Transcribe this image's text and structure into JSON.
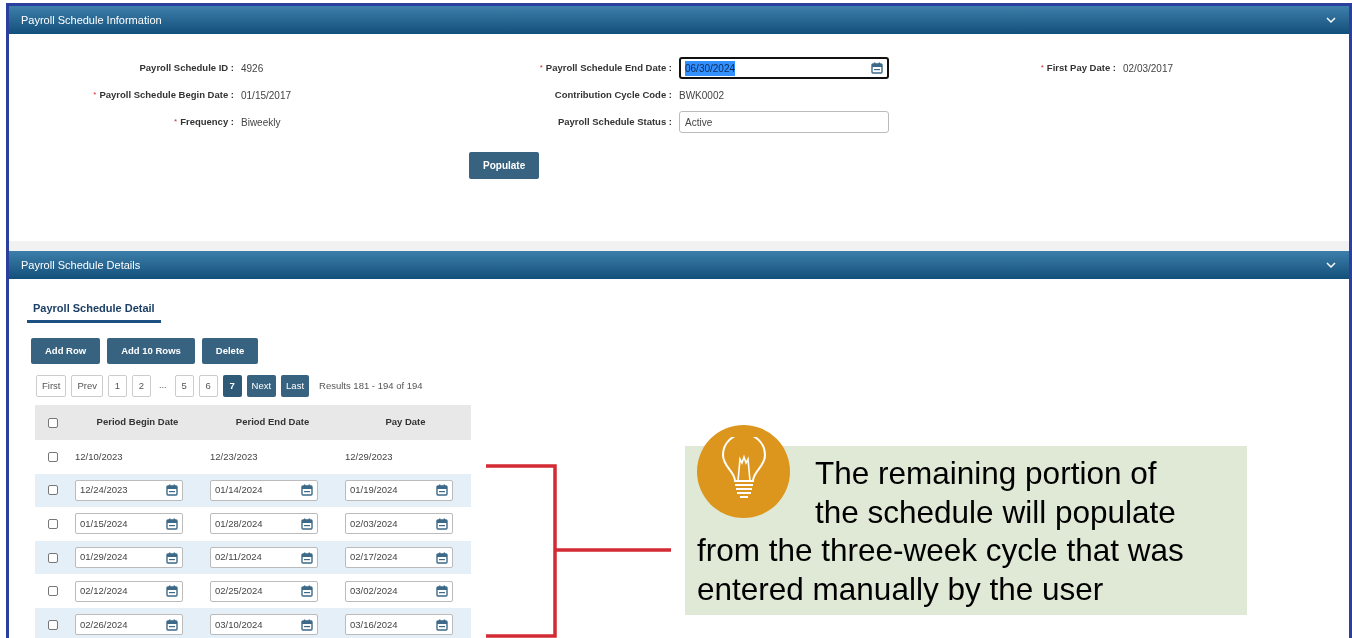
{
  "info_section": {
    "title": "Payroll Schedule Information",
    "expanded": true,
    "left_fields": [
      {
        "label": "Payroll Schedule ID :",
        "value": "4926",
        "kind": "text"
      },
      {
        "marker": "*",
        "label": "Payroll Schedule Begin Date :",
        "value": "01/15/2017",
        "kind": "text"
      },
      {
        "marker": "*",
        "label": "Frequency :",
        "value": "Biweekly",
        "kind": "text"
      }
    ],
    "middle_fields": [
      {
        "marker": "*",
        "label": "Payroll Schedule End Date :",
        "value": "06/30/2024",
        "kind": "date",
        "focused": true
      },
      {
        "label": "Contribution Cycle Code :",
        "value": "BWK0002",
        "kind": "text"
      },
      {
        "label": "Payroll Schedule Status :",
        "value": "Active",
        "kind": "input"
      }
    ],
    "right_fields": [
      {
        "marker": "*",
        "label": "First Pay Date :",
        "value": "02/03/2017",
        "kind": "text"
      }
    ],
    "button": "Populate"
  },
  "details_section": {
    "title": "Payroll Schedule Details",
    "expanded": true,
    "tabs": [
      {
        "label": "Payroll Schedule Detail",
        "selected": true
      }
    ],
    "buttons": [
      "Add Row",
      "Add 10 Rows",
      "Delete"
    ],
    "pagination": [
      {
        "label": "First",
        "kind": "page",
        "selected": false
      },
      {
        "label": "Prev",
        "kind": "page",
        "selected": false
      },
      {
        "label": "1",
        "kind": "page",
        "selected": false
      },
      {
        "label": "2",
        "kind": "page",
        "selected": false
      },
      {
        "label": "...",
        "kind": "ellipsis"
      },
      {
        "label": "5",
        "kind": "page",
        "selected": false
      },
      {
        "label": "6",
        "kind": "page",
        "selected": false
      },
      {
        "label": "7",
        "kind": "page",
        "selected": true
      },
      {
        "label": "Next",
        "kind": "nav",
        "selected": false
      },
      {
        "label": "Last",
        "kind": "nav",
        "selected": false
      }
    ],
    "results": "Results 181 - 194 of 194",
    "table": {
      "header_checked": false,
      "columns": [
        "Period Begin Date",
        "Period End Date",
        "Pay Date"
      ],
      "rows": [
        {
          "kind": "text",
          "checked": false,
          "cells": [
            "12/10/2023",
            "12/23/2023",
            "12/29/2023"
          ]
        },
        {
          "kind": "input",
          "checked": false,
          "cells": [
            "12/24/2023",
            "01/14/2024",
            "01/19/2024"
          ]
        },
        {
          "kind": "input",
          "checked": false,
          "cells": [
            "01/15/2024",
            "01/28/2024",
            "02/03/2024"
          ]
        },
        {
          "kind": "input",
          "checked": false,
          "cells": [
            "01/29/2024",
            "02/11/2024",
            "02/17/2024"
          ]
        },
        {
          "kind": "input",
          "checked": false,
          "cells": [
            "02/12/2024",
            "02/25/2024",
            "03/02/2024"
          ]
        },
        {
          "kind": "input",
          "checked": false,
          "cells": [
            "02/26/2024",
            "03/10/2024",
            "03/16/2024"
          ]
        }
      ]
    }
  },
  "callout": {
    "text_blocks": [
      "The remaining portion of the schedule will populate",
      "from the three-week cycle that was entered manually by the user"
    ]
  }
}
